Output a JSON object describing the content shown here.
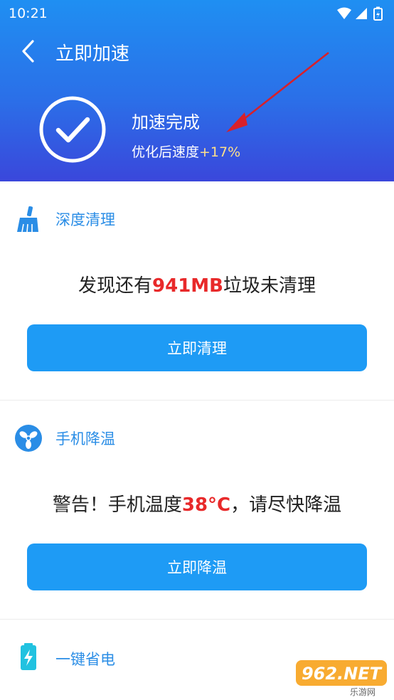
{
  "status_bar": {
    "time": "10:21"
  },
  "header": {
    "title": "立即加速",
    "done_title": "加速完成",
    "speed_prefix": "优化后速度",
    "speed_value": "+17%"
  },
  "sections": [
    {
      "label": "深度清理",
      "msg_before": "发现还有",
      "msg_highlight": "941MB",
      "msg_after": "垃圾未清理",
      "button": "立即清理",
      "icon": "broom-icon"
    },
    {
      "label": "手机降温",
      "msg_before": "警告！手机温度",
      "msg_highlight": "38°C",
      "msg_after": "，请尽快降温",
      "button": "立即降温",
      "icon": "fan-icon"
    },
    {
      "label": "一键省电",
      "icon": "battery-icon"
    }
  ],
  "watermark": {
    "text": "962.NET",
    "sub": "乐游网"
  },
  "colors": {
    "accent": "#1e9bf5",
    "highlight": "#e8292a",
    "header_top": "#1f8ff2",
    "header_bottom": "#3a47db"
  }
}
